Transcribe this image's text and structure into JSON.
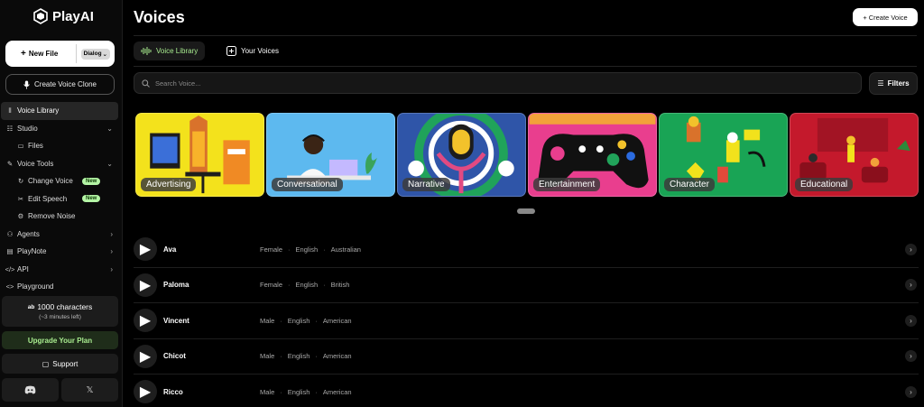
{
  "app": {
    "name": "PlayAI"
  },
  "sidebar": {
    "new_file_label": "New File",
    "dialog_label": "Dialog",
    "clone_label": "Create Voice Clone",
    "nav": [
      {
        "label": "Voice Library",
        "icon": "waveform-icon"
      },
      {
        "label": "Studio",
        "icon": "studio-icon"
      },
      {
        "label": "Files",
        "icon": "folder-icon"
      },
      {
        "label": "Voice Tools",
        "icon": "wrench-icon"
      },
      {
        "label": "Change Voice",
        "icon": "refresh-icon",
        "badge": "New"
      },
      {
        "label": "Edit Speech",
        "icon": "scissors-icon",
        "badge": "New"
      },
      {
        "label": "Remove Noise",
        "icon": "gear-icon"
      },
      {
        "label": "Agents",
        "icon": "agent-icon"
      },
      {
        "label": "PlayNote",
        "icon": "note-icon"
      },
      {
        "label": "API",
        "icon": "code-icon"
      },
      {
        "label": "Playground",
        "icon": "code-icon"
      }
    ],
    "characters": {
      "badge": "ab",
      "count_text": "1000 characters",
      "time_text": "(~3 minutes left)"
    },
    "upgrade_label": "Upgrade Your Plan",
    "support_label": "Support"
  },
  "header": {
    "title": "Voices",
    "create_label": "Create Voice"
  },
  "tabs": [
    {
      "label": "Voice Library"
    },
    {
      "label": "Your Voices"
    }
  ],
  "search": {
    "placeholder": "Search Voice...",
    "filters_label": "Filters"
  },
  "categories": [
    {
      "label": "Advertising",
      "color": "#f3e21c"
    },
    {
      "label": "Conversational",
      "color": "#5db9ef"
    },
    {
      "label": "Narrative",
      "color": "#2f55a8"
    },
    {
      "label": "Entertainment",
      "color": "#e93e8e"
    },
    {
      "label": "Character",
      "color": "#19a455"
    },
    {
      "label": "Educational",
      "color": "#c4192c"
    }
  ],
  "voices": [
    {
      "name": "Ava",
      "gender": "Female",
      "language": "English",
      "accent": "Australian"
    },
    {
      "name": "Paloma",
      "gender": "Female",
      "language": "English",
      "accent": "British"
    },
    {
      "name": "Vincent",
      "gender": "Male",
      "language": "English",
      "accent": "American"
    },
    {
      "name": "Chicot",
      "gender": "Male",
      "language": "English",
      "accent": "American"
    },
    {
      "name": "Ricco",
      "gender": "Male",
      "language": "English",
      "accent": "American"
    }
  ],
  "colors": {
    "accent_green": "#a8ec8f",
    "background": "#000000",
    "panel": "#1c1c1c"
  }
}
